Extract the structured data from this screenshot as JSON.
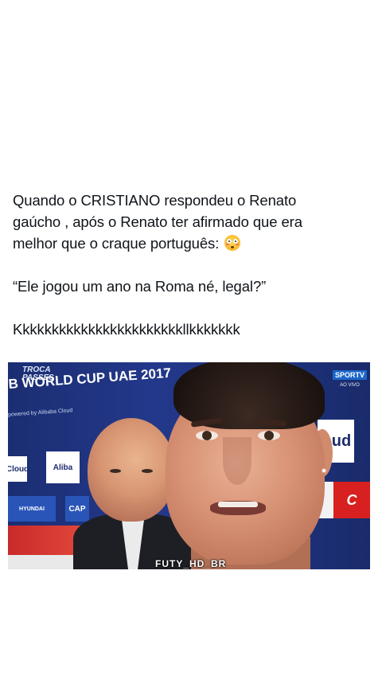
{
  "post": {
    "line1": "Quando o CRISTIANO respondeu o Renato",
    "line2": "gaúcho , após o Renato ter afirmado que era",
    "line3": "melhor que o craque português:",
    "emoji_name": "flushed-face-emoji",
    "quote": "“Ele jogou um ano na Roma né, legal?”",
    "laugh": "Kkkkkkkkkkkkkkkkkkkkkkkllkkkkkkk"
  },
  "media": {
    "troca_line1": "TROCA",
    "troca_line2": "PASSES",
    "event_title": "B WORLD CUP UAE 2017",
    "powered_by": "powered by  Alibaba Cloud",
    "sponsor_cloud": "Cloud",
    "sponsor_alib": "Aliba",
    "sponsor_hyundai": "HYUNDAI",
    "sponsor_cap": "CAP",
    "ad_right": "loud",
    "coke": "C",
    "channel": "SPORTV",
    "channel_live": "AO VIVO",
    "watermark": "FUTY_HD_BR"
  },
  "colors": {
    "backdrop_blue": "#1e3380",
    "sportv_blue": "#1b66c9",
    "coke_red": "#d7201f"
  }
}
